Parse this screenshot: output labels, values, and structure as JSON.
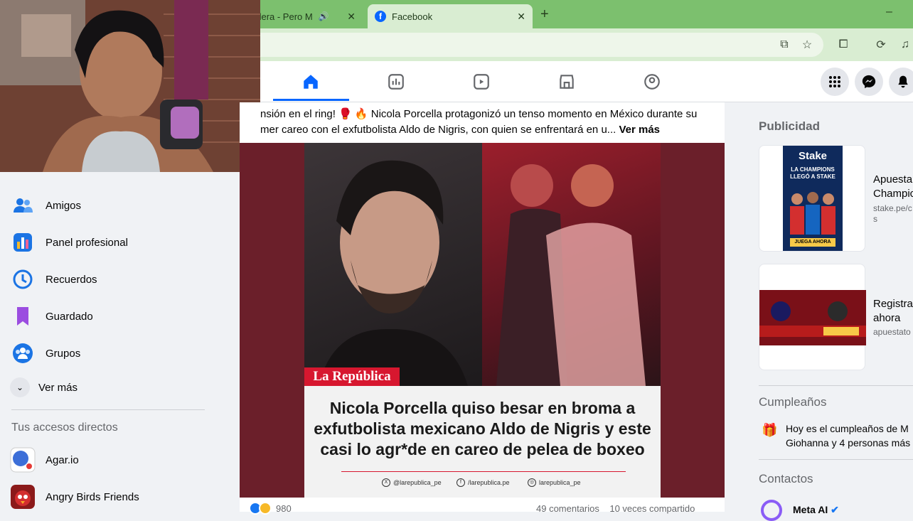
{
  "browser": {
    "tab1_title": "aguilera - Pero M",
    "tab2_title": "Facebook",
    "new_tab": "+",
    "minimize": "–"
  },
  "sidebar": {
    "items": [
      {
        "label": "Amigos"
      },
      {
        "label": "Panel profesional"
      },
      {
        "label": "Recuerdos"
      },
      {
        "label": "Guardado"
      },
      {
        "label": "Grupos"
      },
      {
        "label": "Ver más"
      }
    ],
    "shortcuts_title": "Tus accesos directos",
    "shortcuts": [
      {
        "label": "Agar.io"
      },
      {
        "label": "Angry Birds Friends"
      }
    ]
  },
  "post": {
    "text_line1": "nsión en el ring! 🥊 🔥 Nicola Porcella protagonizó un tenso momento en México durante su",
    "text_line2": "mer careo con el exfutbolista Aldo de Nigris, con quien se enfrentará en u...",
    "see_more": "Ver más",
    "badge": "La República",
    "headline": "Nicola Porcella quiso besar en broma a exfutbolista mexicano Aldo de Nigris y este casi lo agr*de en careo de pelea de boxeo",
    "social_x": "@larepublica_pe",
    "social_fb": "/larepublica.pe",
    "social_ig": "larepublica_pe",
    "reaction_count": "980",
    "comments": "49 comentarios",
    "shares": "10 veces compartido"
  },
  "right": {
    "ads_title": "Publicidad",
    "ad1": {
      "title": "Apuesta Champic",
      "url": "stake.pe/c s",
      "art_line1": "Stake",
      "art_line2": "LA CHAMPIONS LLEGÓ A STAKE",
      "art_cta": "JUEGA AHORA"
    },
    "ad2": {
      "title": "Registra ahora",
      "url": "apuestato"
    },
    "birthdays_title": "Cumpleaños",
    "birthday_text": "Hoy es el cumpleaños de M Giohanna y 4 personas más",
    "contacts_title": "Contactos",
    "contact1": "Meta AI"
  },
  "colors": {
    "accent": "#0866ff",
    "chrome": "#7cc06e"
  }
}
